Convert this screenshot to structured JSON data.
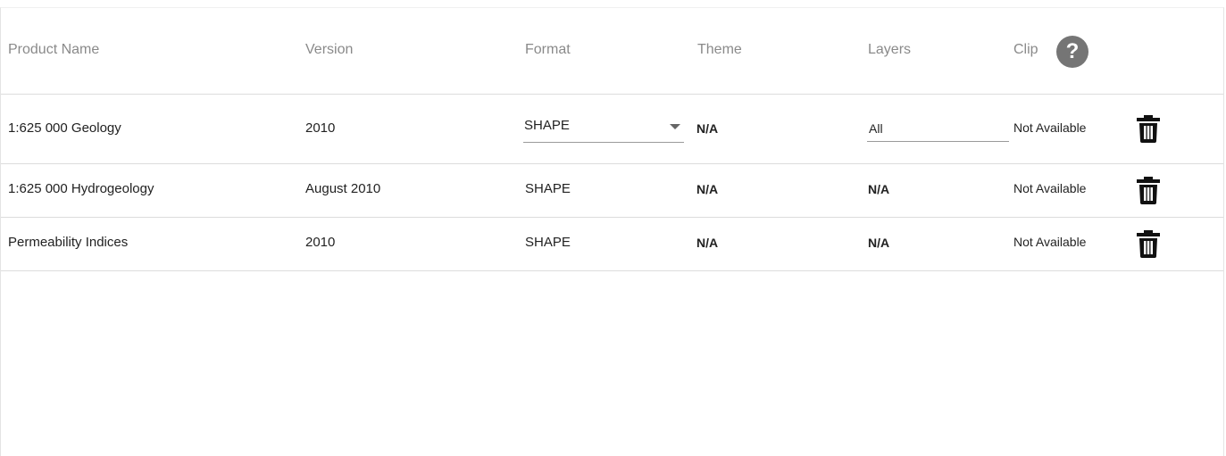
{
  "table": {
    "columns": {
      "product_name": "Product Name",
      "version": "Version",
      "format": "Format",
      "theme": "Theme",
      "layers": "Layers",
      "clip": "Clip"
    },
    "help_icon": "question-circle-icon",
    "help_glyph": "?",
    "rows": [
      {
        "product_name": "1:625 000 Geology",
        "version": "2010",
        "format": "SHAPE",
        "theme": "N/A",
        "layers": "All",
        "clip": "Not Available",
        "delete_icon": "trash-icon"
      },
      {
        "product_name": "1:625 000 Hydrogeology",
        "version": "August 2010",
        "format": "SHAPE",
        "theme": "N/A",
        "layers": "N/A",
        "clip": "Not Available",
        "delete_icon": "trash-icon"
      },
      {
        "product_name": "Permeability Indices",
        "version": "2010",
        "format": "SHAPE",
        "theme": "N/A",
        "layers": "N/A",
        "clip": "Not Available",
        "delete_icon": "trash-icon"
      }
    ]
  },
  "colors": {
    "header_text": "#8a8a8a",
    "body_text": "#222222",
    "divider": "#dcdcdc",
    "help_icon_bg": "#757575"
  }
}
